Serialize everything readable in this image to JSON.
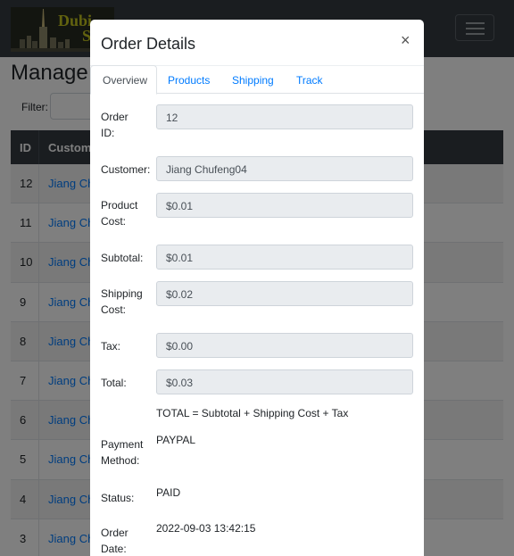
{
  "brand": {
    "line1": "Dubi",
    "line2": "S"
  },
  "page": {
    "heading": "Manage",
    "filter_label": "Filter:",
    "table": {
      "col_id": "ID",
      "col_customer": "Custome",
      "rows": [
        {
          "id": "12",
          "customer": "Jiang Chu"
        },
        {
          "id": "11",
          "customer": "Jiang Chu"
        },
        {
          "id": "10",
          "customer": "Jiang Chu"
        },
        {
          "id": "9",
          "customer": "Jiang Chu"
        },
        {
          "id": "8",
          "customer": "Jiang Chu"
        },
        {
          "id": "7",
          "customer": "Jiang Chu"
        },
        {
          "id": "6",
          "customer": "Jiang Chu"
        },
        {
          "id": "5",
          "customer": "Jiang Chu"
        },
        {
          "id": "4",
          "customer": "Jiang Chu"
        },
        {
          "id": "3",
          "customer": "Jiang Chu"
        }
      ]
    }
  },
  "modal": {
    "title": "Order Details",
    "close_glyph": "×",
    "tabs": [
      "Overview",
      "Products",
      "Shipping",
      "Track"
    ],
    "labels": {
      "order_id_1": "Order",
      "order_id_2": "ID:",
      "customer": "Customer:",
      "product_cost_1": "Product",
      "product_cost_2": "Cost:",
      "subtotal": "Subtotal:",
      "shipping_cost_1": "Shipping",
      "shipping_cost_2": "Cost:",
      "tax": "Tax:",
      "total": "Total:",
      "payment_1": "Payment",
      "payment_2": "Method:",
      "status": "Status:",
      "order_date_1": "Order",
      "order_date_2": "Date:"
    },
    "values": {
      "order_id": "12",
      "customer": "Jiang Chufeng04",
      "product_cost": "$0.01",
      "subtotal": "$0.01",
      "shipping_cost": "$0.02",
      "tax": "$0.00",
      "total": "$0.03",
      "total_formula": "TOTAL = Subtotal + Shipping Cost + Tax",
      "payment_method": "PAYPAL",
      "status": "PAID",
      "order_date": "2022-09-03 13:42:15"
    }
  },
  "colors": {
    "navbar": "#343a40",
    "link": "#007bff",
    "readonly_field": "#e9ecef",
    "logo_text": "#c4c41e"
  }
}
